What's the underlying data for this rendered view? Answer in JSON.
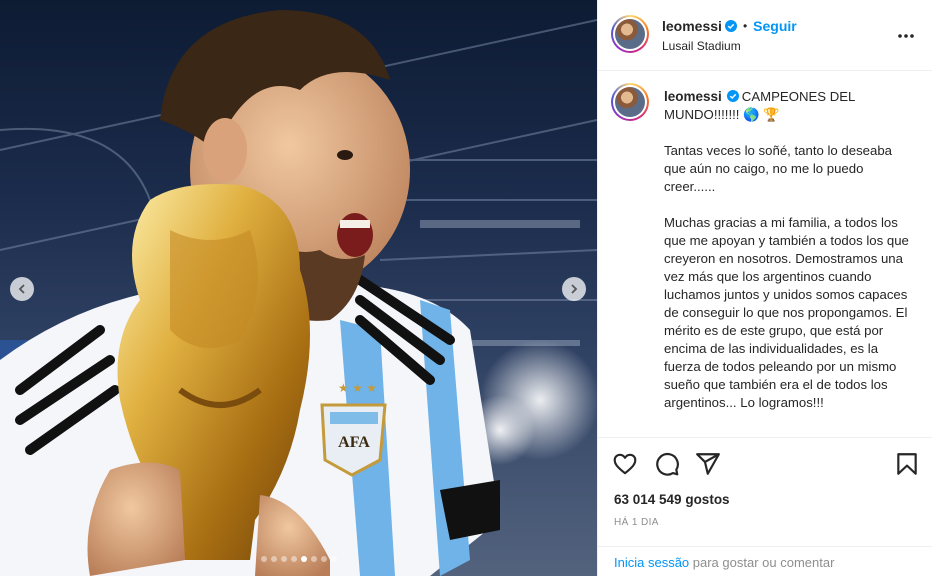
{
  "post": {
    "carousel_dots": 8,
    "active_dot": 4
  },
  "header": {
    "username": "leomessi",
    "separator": "•",
    "follow_label": "Seguir",
    "location": "Lusail Stadium"
  },
  "caption": {
    "username": "leomessi",
    "headline": "CAMPEONES DEL MUNDO!!!!!!! 🌎 🏆",
    "paragraph1": "Tantas veces lo soñé, tanto lo deseaba que aún no caigo, no me lo puedo creer......",
    "paragraph2": "Muchas gracias a mi familia, a todos los que me apoyan y también a todos los que creyeron en nosotros. Demostramos una vez más que los argentinos cuando luchamos juntos y unidos somos capaces de conseguir lo que nos propongamos. El mérito es de este grupo, que está por encima de las individualidades, es la fuerza de todos peleando por un mismo sueño que también era el de todos los argentinos... Lo logramos!!!"
  },
  "actions": {
    "icons": [
      "heart-icon",
      "comment-icon",
      "share-icon",
      "bookmark-icon"
    ],
    "likes": "63 014 549 gostos",
    "time": "HÁ 1 DIA"
  },
  "login": {
    "link_label": "Inicia sessão",
    "rest_label": " para gostar ou comentar"
  },
  "crest": {
    "text": "AFA"
  },
  "colors": {
    "accent": "#0095f6",
    "verified": "#0095f6",
    "text": "#262626",
    "muted": "#8e8e8e",
    "border": "#efefef"
  }
}
